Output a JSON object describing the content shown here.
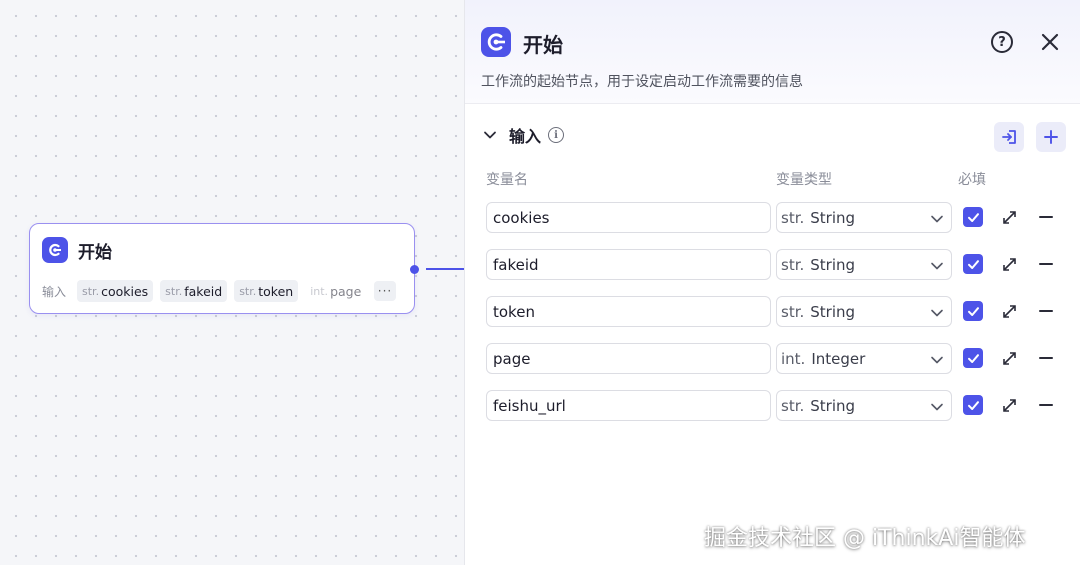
{
  "node": {
    "title": "开始",
    "input_label": "输入",
    "params": [
      {
        "type": "str.",
        "name": "cookies"
      },
      {
        "type": "str.",
        "name": "fakeid"
      },
      {
        "type": "str.",
        "name": "token"
      },
      {
        "type": "int.",
        "name": "page"
      }
    ],
    "more_label": "···"
  },
  "panel": {
    "title": "开始",
    "description": "工作流的起始节点，用于设定启动工作流需要的信息",
    "help_icon": "question-circle-icon",
    "close_icon": "close-icon",
    "accent_color": "#4d53e8",
    "section": {
      "title": "输入",
      "columns": {
        "name": "变量名",
        "type": "变量类型",
        "required": "必填"
      },
      "variables": [
        {
          "name": "cookies",
          "type_prefix": "str.",
          "type": "String",
          "required": true
        },
        {
          "name": "fakeid",
          "type_prefix": "str.",
          "type": "String",
          "required": true
        },
        {
          "name": "token",
          "type_prefix": "str.",
          "type": "String",
          "required": true
        },
        {
          "name": "page",
          "type_prefix": "int.",
          "type": "Integer",
          "required": true
        },
        {
          "name": "feishu_url",
          "type_prefix": "str.",
          "type": "String",
          "required": true
        }
      ]
    }
  },
  "watermark": "掘金技术社区 @ iThinkAi智能体"
}
